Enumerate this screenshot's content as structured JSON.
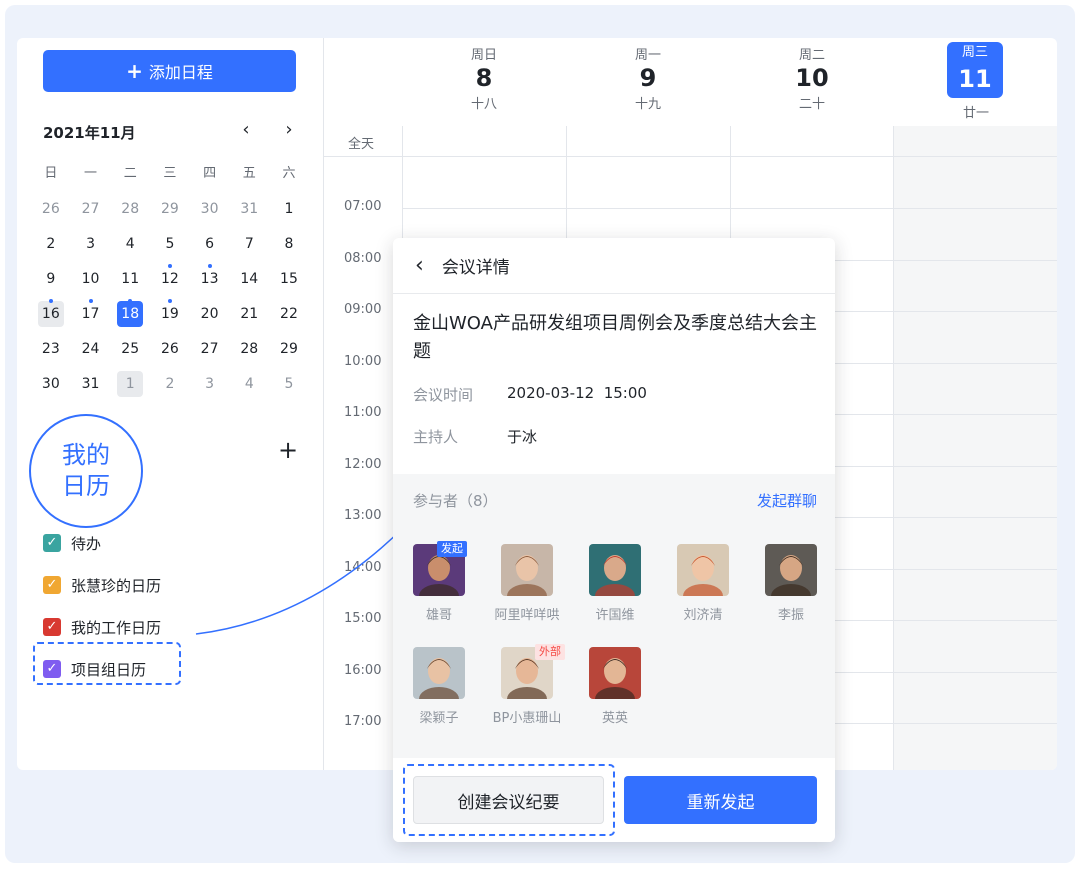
{
  "sidebar": {
    "add_button": "添加日程",
    "month_title": "2021年11月",
    "prev_icon": "chevron-left-icon",
    "next_icon": "chevron-right-icon",
    "weekday_headers": [
      "日",
      "一",
      "二",
      "三",
      "四",
      "五",
      "六"
    ],
    "weeks": [
      [
        {
          "d": "26",
          "muted": true
        },
        {
          "d": "27",
          "muted": true
        },
        {
          "d": "28",
          "muted": true
        },
        {
          "d": "29",
          "muted": true
        },
        {
          "d": "30",
          "muted": true
        },
        {
          "d": "31",
          "muted": true
        },
        {
          "d": "1"
        }
      ],
      [
        {
          "d": "2"
        },
        {
          "d": "3"
        },
        {
          "d": "4"
        },
        {
          "d": "5"
        },
        {
          "d": "6"
        },
        {
          "d": "7"
        },
        {
          "d": "8"
        }
      ],
      [
        {
          "d": "9"
        },
        {
          "d": "10"
        },
        {
          "d": "11"
        },
        {
          "d": "12",
          "dot": true
        },
        {
          "d": "13",
          "dot": true
        },
        {
          "d": "14"
        },
        {
          "d": "15"
        }
      ],
      [
        {
          "d": "16",
          "dot": true,
          "selected": true
        },
        {
          "d": "17",
          "dot": true
        },
        {
          "d": "18",
          "dot": true,
          "today": true
        },
        {
          "d": "19",
          "dot": true
        },
        {
          "d": "20"
        },
        {
          "d": "21"
        },
        {
          "d": "22"
        }
      ],
      [
        {
          "d": "23"
        },
        {
          "d": "24"
        },
        {
          "d": "25"
        },
        {
          "d": "26"
        },
        {
          "d": "27"
        },
        {
          "d": "28"
        },
        {
          "d": "29"
        }
      ],
      [
        {
          "d": "30"
        },
        {
          "d": "31"
        },
        {
          "d": "1",
          "muted": true,
          "selected": true
        },
        {
          "d": "2",
          "muted": true
        },
        {
          "d": "3",
          "muted": true
        },
        {
          "d": "4",
          "muted": true
        },
        {
          "d": "5",
          "muted": true
        }
      ]
    ],
    "my_calendars_label": "我的日历",
    "calendars": [
      {
        "label": "待办",
        "color": "#3aa4a0"
      },
      {
        "label": "张慧珍的日历",
        "color": "#f0a732"
      },
      {
        "label": "我的工作日历",
        "color": "#d83931"
      },
      {
        "label": "项目组日历",
        "color": "#7f5cf0"
      }
    ]
  },
  "week": {
    "days": [
      {
        "weekday": "周日",
        "date": "8",
        "lunar": "十八"
      },
      {
        "weekday": "周一",
        "date": "9",
        "lunar": "十九"
      },
      {
        "weekday": "周二",
        "date": "10",
        "lunar": "二十"
      },
      {
        "weekday": "周三",
        "date": "11",
        "lunar": "廿一",
        "today": true
      }
    ],
    "all_day_label": "全天",
    "times": [
      "07:00",
      "08:00",
      "09:00",
      "10:00",
      "11:00",
      "12:00",
      "13:00",
      "14:00",
      "15:00",
      "16:00",
      "17:00"
    ]
  },
  "popup": {
    "header": "会议详情",
    "title": "金山WOA产品研发组项目周例会及季度总结大会主题",
    "time_label": "会议时间",
    "time_value": "2020-03-12  15:00",
    "host_label": "主持人",
    "host_value": "于冰",
    "attendees_label": "参与者（8）",
    "group_chat": "发起群聊",
    "attendees": [
      {
        "name": "雄哥",
        "tag": "发起",
        "bg": "#5b3a7a",
        "skin": "#c98e6c",
        "hair": "#3a2a22"
      },
      {
        "name": "阿里咩咩哄",
        "bg": "#c7b6a8",
        "skin": "#e9c4a8",
        "hair": "#8a5a3c"
      },
      {
        "name": "许国维",
        "bg": "#2f6f74",
        "skin": "#d9a98a",
        "hair": "#c0392b"
      },
      {
        "name": "刘济清",
        "bg": "#d8c9b4",
        "skin": "#efc5a6",
        "hair": "#c8552c"
      },
      {
        "name": "李振",
        "bg": "#5e5a55",
        "skin": "#d6a684",
        "hair": "#3b2b20"
      },
      {
        "name": "梁颖子",
        "bg": "#b9c3c9",
        "skin": "#e8c2a4",
        "hair": "#6b4a33"
      },
      {
        "name": "BP小惠珊山",
        "tag": "外部",
        "bg": "#e0d6c8",
        "skin": "#e6b797",
        "hair": "#5a3a26"
      },
      {
        "name": "英英",
        "bg": "#b8463a",
        "skin": "#e3b695",
        "hair": "#3a2822"
      }
    ],
    "minutes_button": "创建会议纪要",
    "resend_button": "重新发起"
  }
}
